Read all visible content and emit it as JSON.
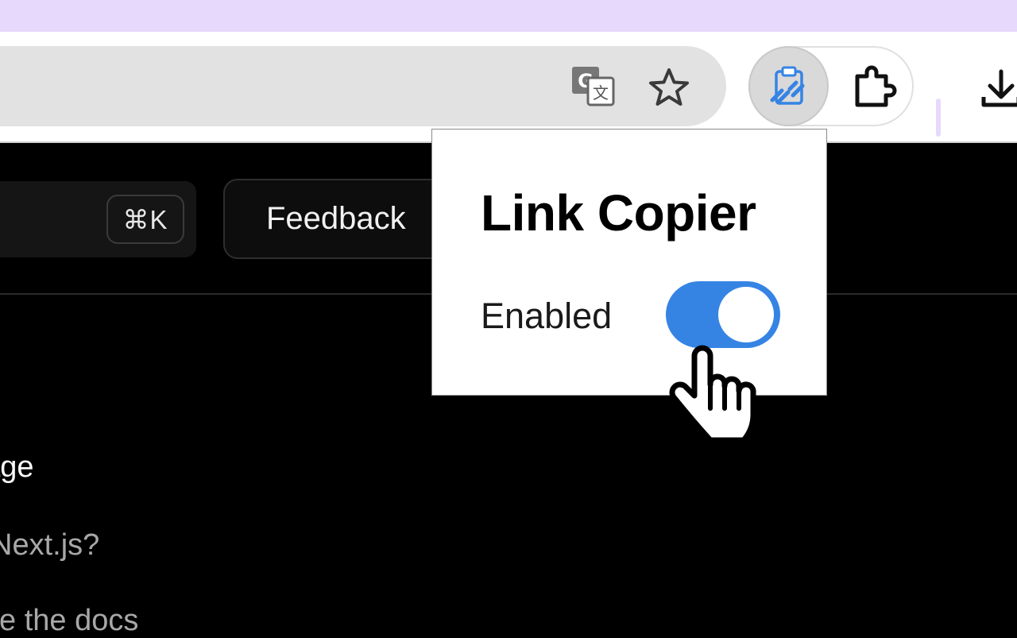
{
  "browser": {
    "toolbar": {
      "translate_icon": "google-translate-icon",
      "bookmark_icon": "star-icon",
      "active_extension_icon": "link-copier-icon",
      "extensions_icon": "puzzle-icon",
      "downloads_icon": "download-icon"
    },
    "colors": {
      "tabstrip": "#e6d9fb",
      "accent": "#3584e4"
    }
  },
  "page": {
    "search": {
      "shortcut": "⌘K"
    },
    "feedback_label": "Feedback",
    "nav_items": [
      "page",
      "Next.js?",
      "se the docs"
    ]
  },
  "popup": {
    "title": "Link Copier",
    "toggle_label": "Enabled",
    "toggle_state": "on"
  }
}
